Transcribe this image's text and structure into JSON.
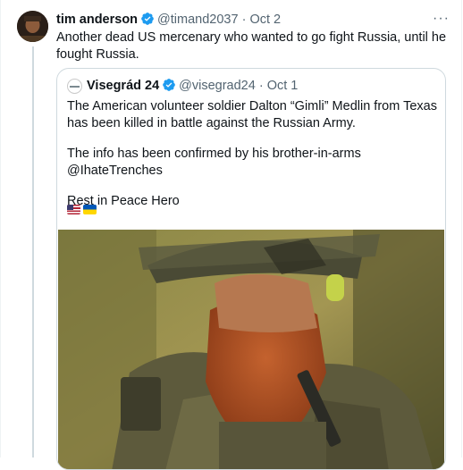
{
  "tweet": {
    "author_name": "tim anderson",
    "handle": "@timand2037",
    "separator": "·",
    "date": "Oct 2",
    "more": "···",
    "text": "Another dead US mercenary who wanted to go fight Russia, until he fought Russia."
  },
  "quote": {
    "author_name": "Visegrád 24",
    "handle": "@visegrad24",
    "separator": "·",
    "date": "Oct 1",
    "paragraph_1": "The American volunteer soldier Dalton “Gimli” Medlin from Texas has been killed in battle against the Russian Army.",
    "paragraph_2": "The info has been confirmed by his brother-in-arms @IhateTrenches",
    "paragraph_3": "Rest in Peace Hero",
    "flags": [
      "us-flag-icon",
      "ukraine-flag-icon"
    ]
  },
  "colors": {
    "verified": "#1d9bf0",
    "muted": "#536471",
    "border": "#cfd9de"
  }
}
